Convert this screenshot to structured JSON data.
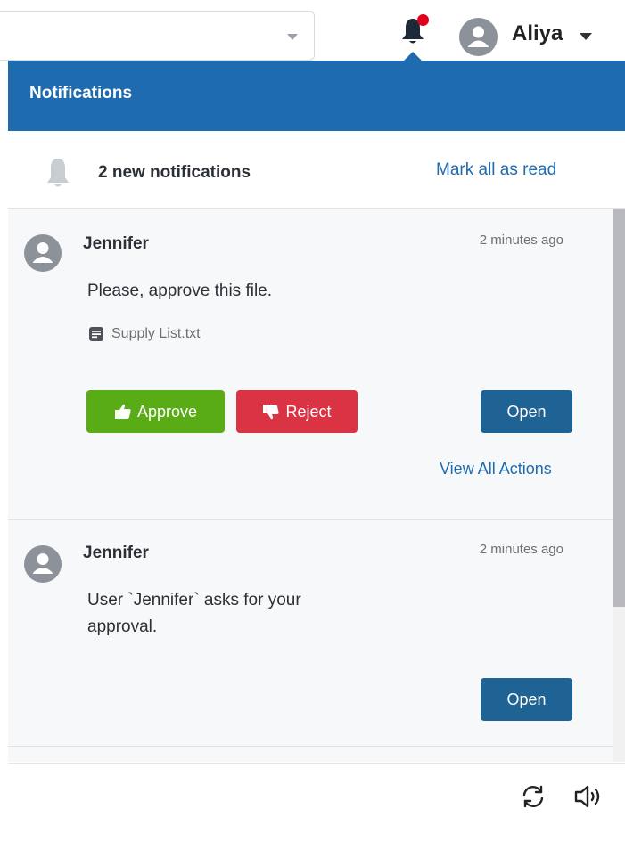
{
  "topbar": {
    "select_value": "",
    "user_name": "Aliya",
    "icons": {
      "bell": "bell-icon",
      "avatar": "user-avatar-icon",
      "caret": "caret-down-icon"
    }
  },
  "panel": {
    "title": "Notifications",
    "summary": "2 new notifications",
    "mark_all_label": "Mark all as read"
  },
  "notifications": [
    {
      "sender": "Jennifer",
      "time": "2 minutes ago",
      "message": "Please, approve this file.",
      "attachment": "Supply List.txt",
      "approve_label": "Approve",
      "reject_label": "Reject",
      "open_label": "Open",
      "view_all_label": "View All Actions"
    },
    {
      "sender": "Jennifer",
      "time": "2 minutes ago",
      "message_line1": "User `Jennifer` asks for your",
      "message_line2": "approval.",
      "open_label": "Open"
    }
  ],
  "footer": {
    "icons": [
      "refresh-icon",
      "sound-icon"
    ]
  },
  "colors": {
    "header": "#1f6bb0",
    "approve": "#5aac17",
    "reject": "#d93344",
    "open": "#1f6294",
    "badge": "#e0001b",
    "link": "#1f6bb0"
  }
}
